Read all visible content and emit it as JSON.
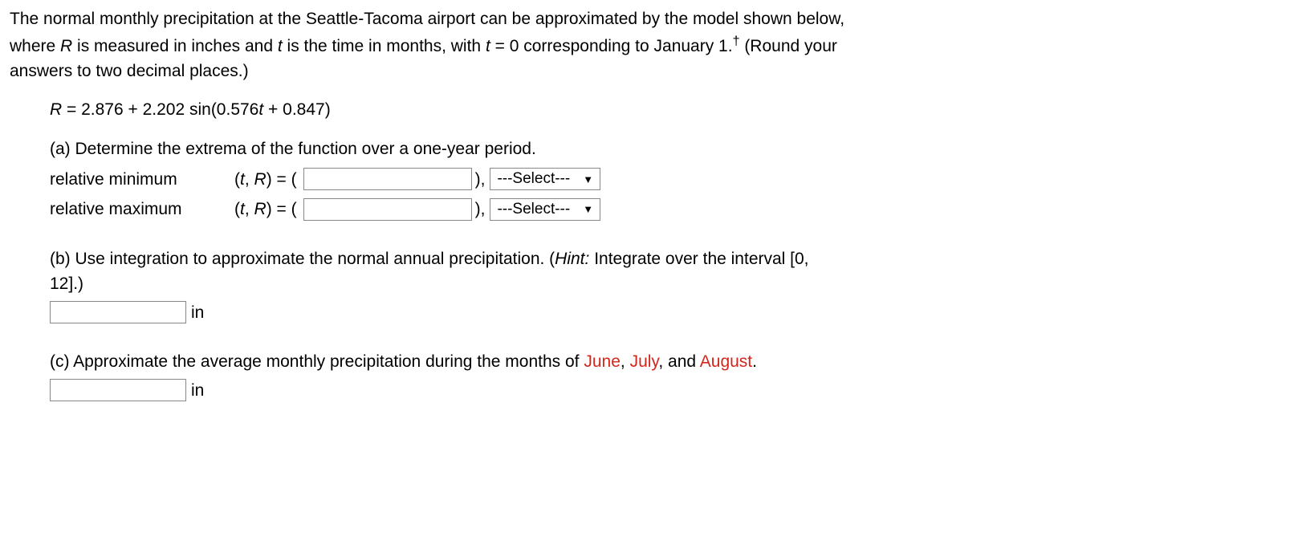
{
  "intro": {
    "line1a": "The normal monthly precipitation at the Seattle-Tacoma airport can be approximated by the model shown below,",
    "line2a": "where ",
    "var_R": "R",
    "line2b": " is measured in inches and ",
    "var_t": "t",
    "line2c": " is the time in months, with ",
    "line2d": " = 0 corresponding to January 1.",
    "dagger": "†",
    "line2e": " (Round your",
    "line3": "answers to two decimal places.)"
  },
  "equation": {
    "R": "R",
    "rest": " = 2.876 + 2.202 sin(0.576",
    "t": "t",
    "rest2": " + 0.847)"
  },
  "partA": {
    "prompt": "(a) Determine the extrema of the function over a one-year period.",
    "min_label": "relative minimum",
    "max_label": "relative maximum",
    "tr_open": "(",
    "tr_t": "t",
    "tr_comma": ", ",
    "tr_R": "R",
    "tr_close_eq": ") = (",
    "paren_close": "),",
    "select_placeholder": "---Select---"
  },
  "partB": {
    "prompt_a": "(b) Use integration to approximate the normal annual precipitation. (",
    "hint_label": "Hint:",
    "hint_text": " Integrate over the interval [0,",
    "prompt_b": "12].)",
    "unit": "in"
  },
  "partC": {
    "prompt_a": "(c) Approximate the average monthly precipitation during the months of ",
    "june": "June",
    "comma1": ", ",
    "july": "July",
    "comma2": ", and ",
    "august": "August",
    "period": ".",
    "unit": "in"
  }
}
